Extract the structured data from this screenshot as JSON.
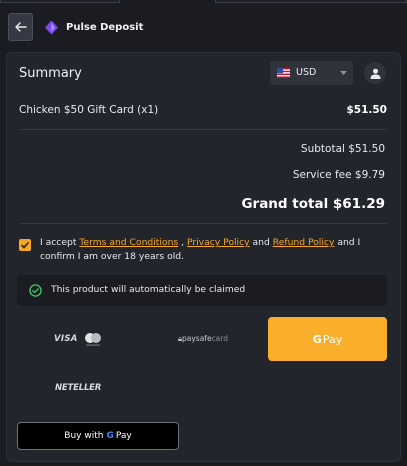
{
  "header": {
    "brand": "Pulse Deposit",
    "back_icon": "arrow-left-icon",
    "logo_icon": "pulse-logo-icon"
  },
  "summary": {
    "title": "Summary",
    "currency": {
      "flag_icon": "us-flag-icon",
      "selected": "USD"
    },
    "user_icon": "user-icon"
  },
  "item": {
    "name": "Chicken $50 Gift Card (x1)",
    "price": "$51.50"
  },
  "totals": {
    "subtotal": "Subtotal $51.50",
    "service_fee": "Service fee $9.79",
    "grand_total": "Grand total $61.29"
  },
  "terms": {
    "checked": true,
    "prefix": "I accept ",
    "terms_link": "Terms and Conditions",
    "sep1": " , ",
    "privacy_link": "Privacy Policy",
    "sep2": " and ",
    "refund_link": "Refund Policy",
    "suffix": " and I confirm I am over 18 years old."
  },
  "claim": {
    "text": "This product will automatically be claimed"
  },
  "payment_methods": {
    "visa": "VISA",
    "paysafe_main": "paysafe",
    "paysafe_sub": "card",
    "gpay_g": "G",
    "gpay_label": "Pay",
    "neteller": "NETELLER"
  },
  "buy_button": {
    "prefix": "Buy with",
    "g": "G",
    "label": "Pay"
  },
  "colors": {
    "accent": "#f9ae2c",
    "background": "#1a1c21",
    "card": "#23252c"
  }
}
